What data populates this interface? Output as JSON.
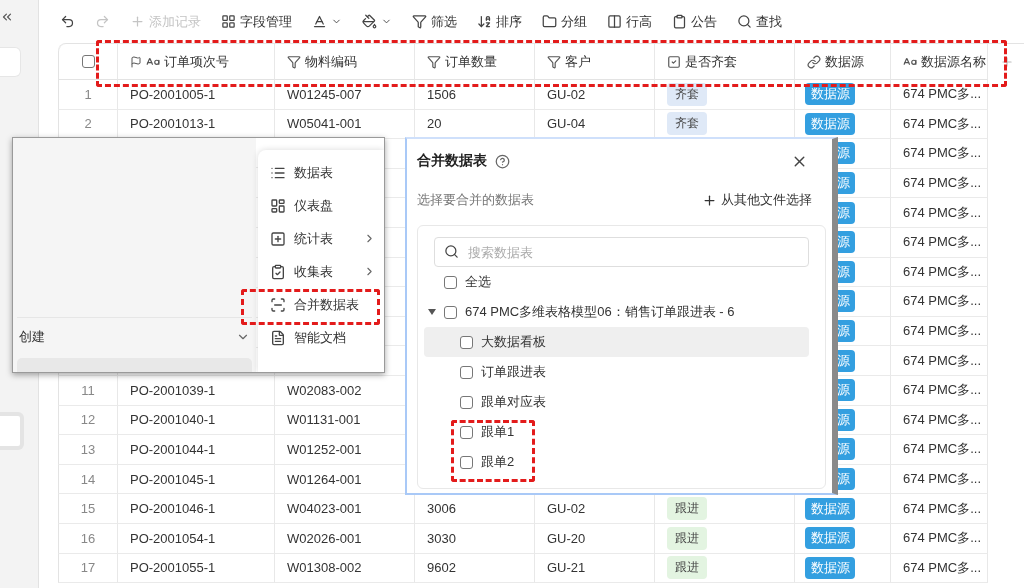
{
  "toolbar": [
    {
      "kind": "icon",
      "disabled": false
    },
    {
      "kind": "icon",
      "disabled": true
    },
    {
      "kind": "button",
      "label": "添加记录",
      "disabled": true
    },
    {
      "kind": "button",
      "label": "字段管理",
      "disabled": false
    },
    {
      "kind": "dropdown",
      "disabled": false
    },
    {
      "kind": "dropdown",
      "disabled": false
    },
    {
      "kind": "button",
      "label": "筛选",
      "disabled": false
    },
    {
      "kind": "button",
      "label": "排序",
      "disabled": false
    },
    {
      "kind": "button",
      "label": "分组",
      "disabled": false
    },
    {
      "kind": "button",
      "label": "行高",
      "disabled": false
    },
    {
      "kind": "button",
      "label": "公告",
      "disabled": false
    },
    {
      "kind": "button",
      "label": "查找",
      "disabled": false
    }
  ],
  "table": {
    "all_checked": false,
    "columns": [
      {
        "label": "订单项次号"
      },
      {
        "label": "物料编码"
      },
      {
        "label": "订单数量"
      },
      {
        "label": "客户"
      },
      {
        "label": "是否齐套"
      },
      {
        "label": "数据源"
      },
      {
        "label": "数据源名称"
      }
    ],
    "rows": [
      {
        "number": "1",
        "order": "PO-2001005-1",
        "material": "W01245-007",
        "qty": "1506",
        "customer": "GU-02",
        "status": {
          "text": "齐套",
          "color": "#dfe9f7"
        },
        "source": "数据源",
        "source_name": "674 PMC多..."
      },
      {
        "number": "2",
        "order": "PO-2001013-1",
        "material": "W05041-001",
        "qty": "20",
        "customer": "GU-04",
        "status": {
          "text": "齐套",
          "color": "#dfe9f7"
        },
        "source": "数据源",
        "source_name": "674 PMC多..."
      },
      {
        "source": "源",
        "source_name": "674 PMC多..."
      },
      {
        "source": "源",
        "source_name": "674 PMC多..."
      },
      {
        "source": "源",
        "source_name": "674 PMC多..."
      },
      {
        "source": "源",
        "source_name": "674 PMC多..."
      },
      {
        "source": "源",
        "source_name": "674 PMC多..."
      },
      {
        "source": "源",
        "source_name": "674 PMC多..."
      },
      {
        "source": "源",
        "source_name": "674 PMC多..."
      },
      {
        "source": "源",
        "source_name": "674 PMC多..."
      },
      {
        "number": "11",
        "order": "PO-2001039-1",
        "material": "W02083-002",
        "source": "源",
        "source_name": "674 PMC多..."
      },
      {
        "number": "12",
        "order": "PO-2001040-1",
        "material": "W01131-001",
        "source": "源",
        "source_name": "674 PMC多..."
      },
      {
        "number": "13",
        "order": "PO-2001044-1",
        "material": "W01252-001",
        "source": "源",
        "source_name": "674 PMC多..."
      },
      {
        "number": "14",
        "order": "PO-2001045-1",
        "material": "W01264-001",
        "source": "源",
        "source_name": "674 PMC多..."
      },
      {
        "number": "15",
        "order": "PO-2001046-1",
        "material": "W04023-001",
        "qty": "3006",
        "customer": "GU-02",
        "status": {
          "text": "跟进",
          "color": "#e3f4e1"
        },
        "source": "数据源",
        "source_name": "674 PMC多..."
      },
      {
        "number": "16",
        "order": "PO-2001054-1",
        "material": "W02026-001",
        "qty": "3030",
        "customer": "GU-20",
        "status": {
          "text": "跟进",
          "color": "#e3f4e1"
        },
        "source": "数据源",
        "source_name": "674 PMC多..."
      },
      {
        "number": "17",
        "order": "PO-2001055-1",
        "material": "W01308-002",
        "qty": "9602",
        "customer": "GU-21",
        "status": {
          "text": "跟进",
          "color": "#e3f4e1"
        },
        "source": "数据源",
        "source_name": "674 PMC多..."
      }
    ]
  },
  "popup": {
    "section_label": "创建",
    "section_expanded": true,
    "menu": [
      {
        "label": "数据表",
        "submenu": false
      },
      {
        "label": "仪表盘",
        "submenu": false
      },
      {
        "label": "统计表",
        "submenu": true
      },
      {
        "label": "收集表",
        "submenu": true
      },
      {
        "label": "合并数据表",
        "submenu": false
      },
      {
        "label": "智能文档",
        "submenu": false
      }
    ]
  },
  "dialog": {
    "title": "合并数据表",
    "subtitle": "选择要合并的数据表",
    "link": "从其他文件选择",
    "search": {
      "placeholder": "搜索数据表"
    },
    "select_all": {
      "label": "全选",
      "checked": false
    },
    "tree": {
      "label": "674 PMC多维表格模型06：销售订单跟进表 - 6",
      "expanded": true,
      "checked": false,
      "children": [
        {
          "label": "大数据看板",
          "checked": false,
          "highlighted": true
        },
        {
          "label": "订单跟进表",
          "checked": false,
          "highlighted": false
        },
        {
          "label": "跟单对应表",
          "checked": false,
          "highlighted": false
        },
        {
          "label": "跟单1",
          "checked": false,
          "highlighted": false
        },
        {
          "label": "跟单2",
          "checked": false,
          "highlighted": false
        }
      ]
    }
  }
}
